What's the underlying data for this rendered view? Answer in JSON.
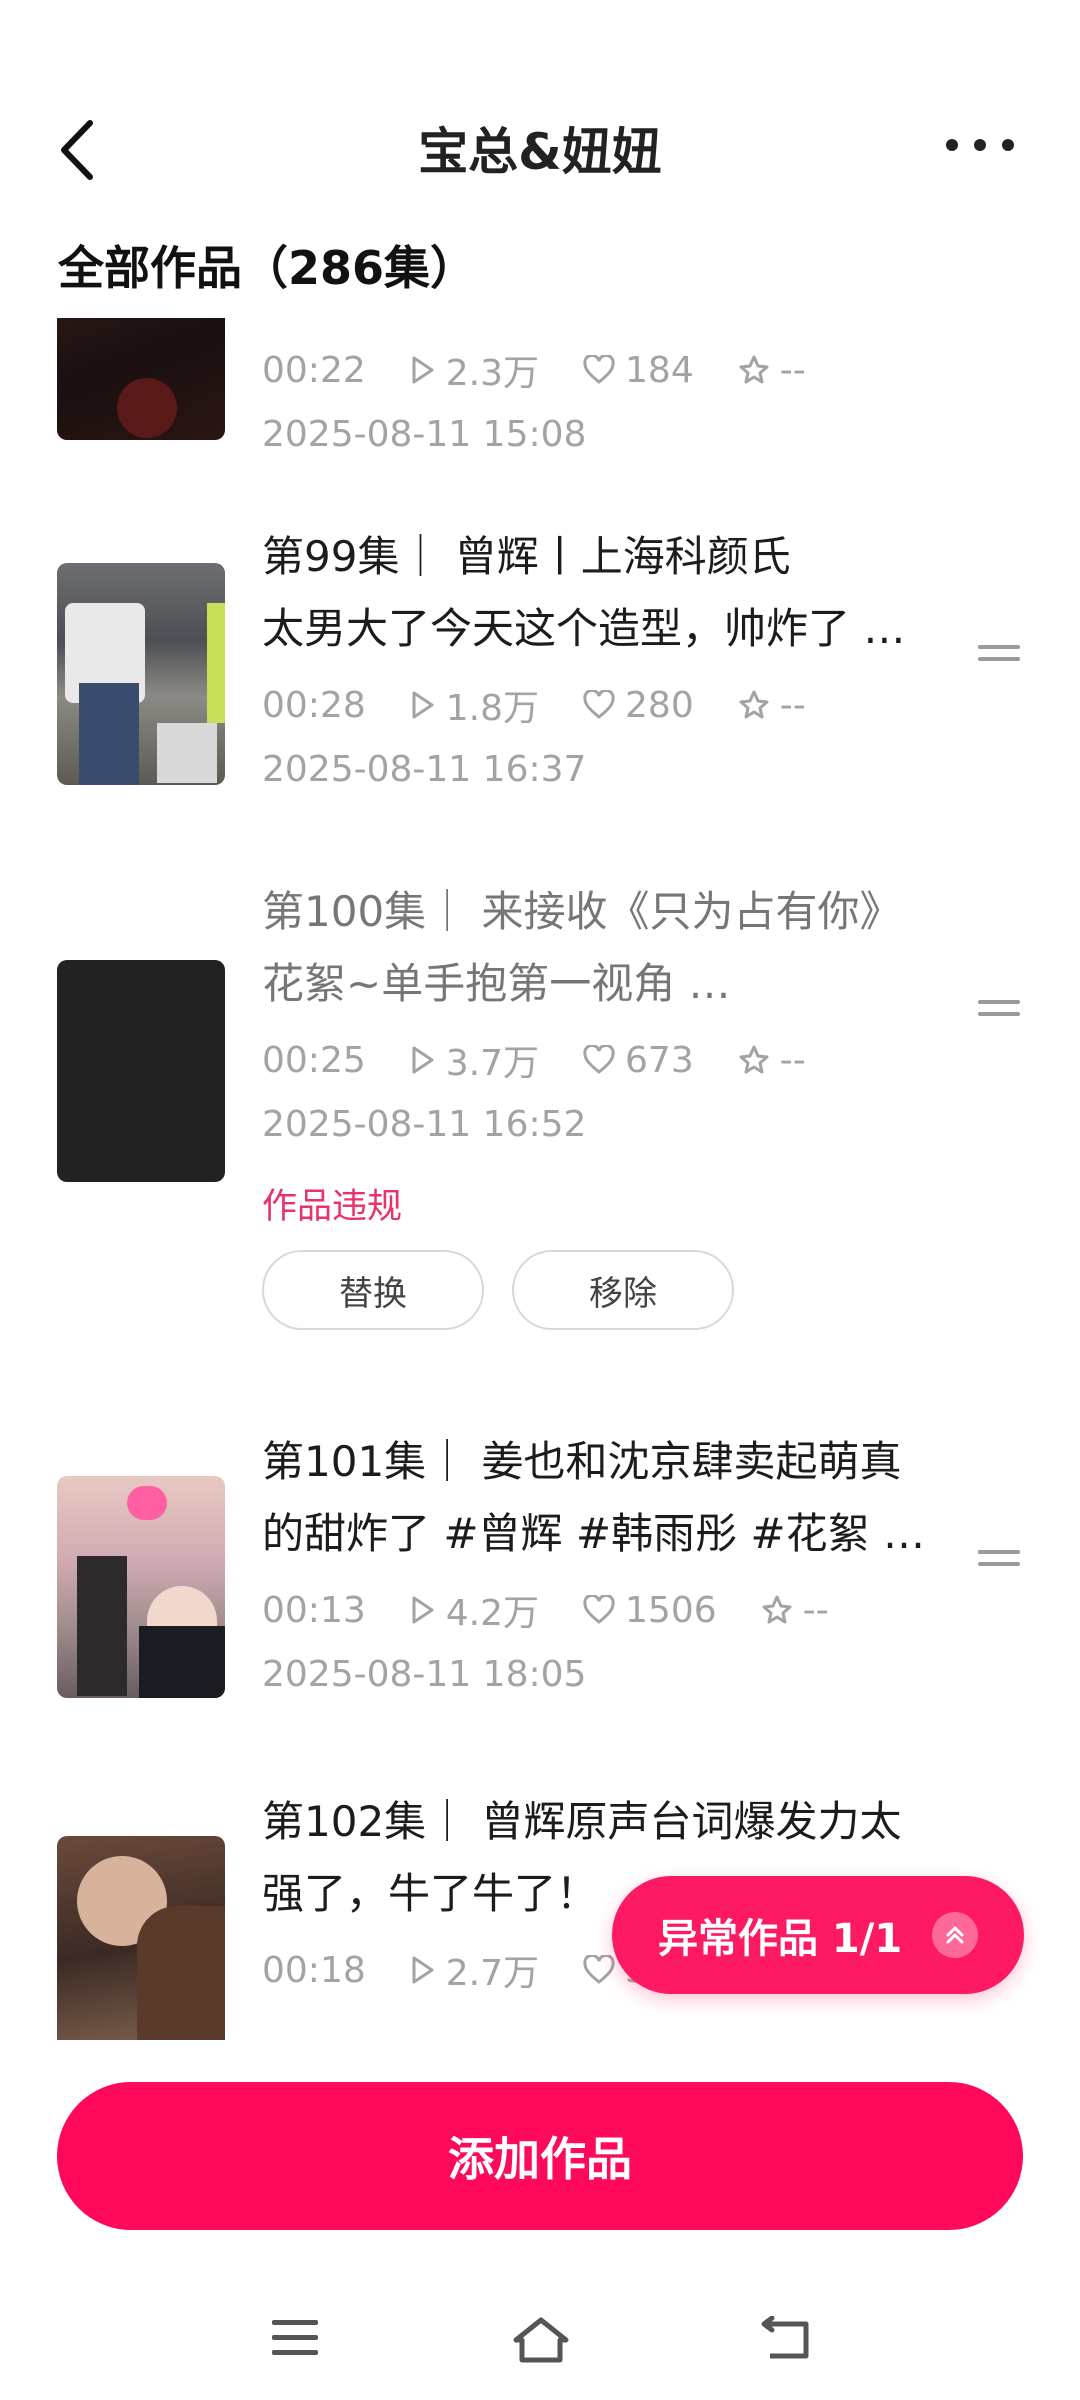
{
  "header": {
    "title": "宝总&妞妞"
  },
  "section_title": "全部作品（286集）",
  "items": [
    {
      "title_line1": "",
      "title_line2": "",
      "duration": "00:22",
      "plays": "2.3万",
      "likes": "184",
      "favs": "--",
      "date": "2025-08-11 15:08"
    },
    {
      "title_line1": "第99集｜ 曾辉丨上海科颜氏",
      "title_line2": "太男大了今天这个造型，帅炸了 …",
      "duration": "00:28",
      "plays": "1.8万",
      "likes": "280",
      "favs": "--",
      "date": "2025-08-11 16:37"
    },
    {
      "title_line1": "第100集｜ 来接收《只为占有你》",
      "title_line2": "花絮~单手抱第一视角 …",
      "duration": "00:25",
      "plays": "3.7万",
      "likes": "673",
      "favs": "--",
      "date": "2025-08-11 16:52",
      "violation": "作品违规",
      "replace": "替换",
      "remove": "移除"
    },
    {
      "title_line1": "第101集｜ 姜也和沈京肆卖起萌真",
      "title_line2": "的甜炸了 #曾辉 #韩雨彤 #花絮 …",
      "duration": "00:13",
      "plays": "4.2万",
      "likes": "1506",
      "favs": "--",
      "date": "2025-08-11 18:05"
    },
    {
      "title_line1": "第102集｜ 曾辉原声台词爆发力太",
      "title_line2": "强了，牛了牛了！",
      "duration": "00:18",
      "plays": "2.7万",
      "likes": "395",
      "favs": "--",
      "date": ""
    }
  ],
  "floating": {
    "label": "异常作品 1/1"
  },
  "add_button": "添加作品",
  "colors": {
    "accent": "#ff0a5a",
    "violation": "#e8336a",
    "muted": "#a3a3a3"
  }
}
